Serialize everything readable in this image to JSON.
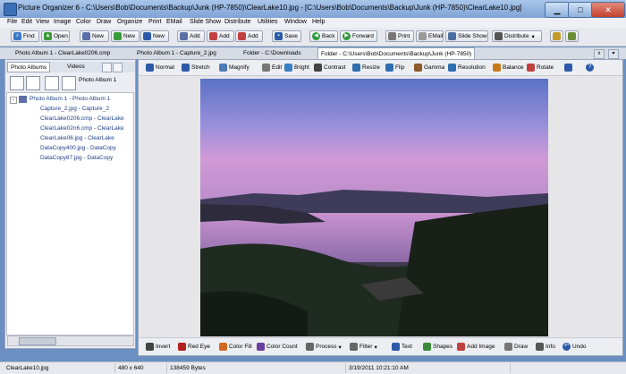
{
  "window": {
    "title": "Picture Organizer 6 - C:\\Users\\Bob\\Documents\\Backup\\Junk (HP-7850)\\ClearLake10.jpg - [C:\\Users\\Bob\\Documents\\Backup\\Junk (HP-7850)\\ClearLake10.jpg]"
  },
  "menu": [
    "File",
    "Edit",
    "View",
    "Image",
    "Color",
    "Draw",
    "Organize",
    "Print",
    "EMail",
    "Slide Show",
    "Distribute",
    "Utilities",
    "Window",
    "Help"
  ],
  "toolbar": {
    "find": "Find",
    "open": "Open",
    "new1": "New",
    "new2": "New",
    "new3": "New",
    "add1": "Add",
    "add2": "Add",
    "add3": "Add",
    "save": "Save",
    "back": "Back",
    "forward": "Forward",
    "print": "Print",
    "email": "EMail",
    "slideshow": "Slide Show",
    "distribute": "Distribute"
  },
  "doc_tabs": [
    "Photo Album 1 - ClearLake0206.cmp",
    "Photo Album 1 - Capture_2.jpg",
    "Folder - C:\\Downloads",
    "Folder - C:\\Users\\Bob\\Documents\\Backup\\Junk (HP-7850)"
  ],
  "left_tabs": {
    "albums": "Photo Albums",
    "videos": "Videos"
  },
  "album_label": "Photo Album 1",
  "tree": {
    "root": "Photo Album 1 - Photo Album 1",
    "items": [
      "Capture_2.jpg - Capture_2",
      "ClearLake0206.cmp - ClearLake",
      "ClearLake02n6.cmp - ClearLake",
      "ClearLake06.jpg - ClearLake",
      "DataCopy400.jpg - DataCopy",
      "DataCopy87.jpg - DataCopy"
    ]
  },
  "image_toolbar": [
    "Normal",
    "Stretch",
    "Magnify",
    "Edit",
    "Bright",
    "Contrast",
    "Resize",
    "Flip",
    "Gamma",
    "Resolution",
    "Balance",
    "Rotate"
  ],
  "bottom_toolbar": [
    "Invert",
    "Red Eye",
    "Color Fill",
    "Color Count",
    "Process",
    "Filter",
    "Text",
    "Shapes",
    "Add Image",
    "Draw",
    "Info",
    "Undo"
  ],
  "status": {
    "file": "ClearLake10.jpg",
    "dims": "480 x 640",
    "bytes": "138459 Bytes",
    "date": "3/19/2011 10:21:10 AM"
  },
  "colors": {
    "title_bg": "#8fb0dc",
    "close": "#c2422d",
    "accent": "#1f3f8a"
  }
}
